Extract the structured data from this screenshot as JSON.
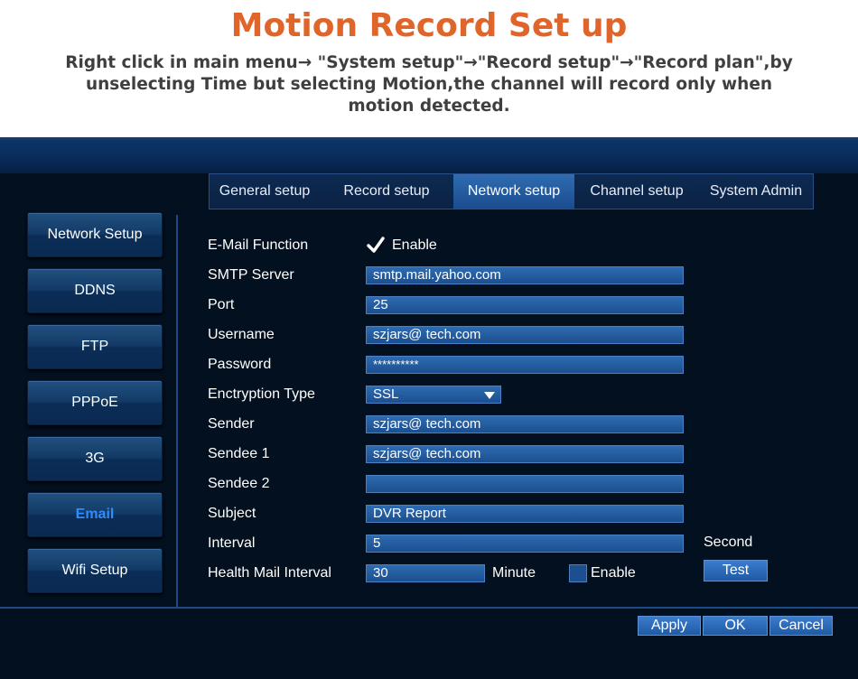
{
  "banner": {
    "title": "Motion Record Set up",
    "subtitle": "Right click in main menu→ \"System setup\"→\"Record setup\"→\"Record plan\",by unselecting Time but selecting Motion,the channel will record only when motion detected."
  },
  "tabs": [
    {
      "label": "General setup"
    },
    {
      "label": "Record setup"
    },
    {
      "label": "Network setup",
      "active": true
    },
    {
      "label": "Channel setup"
    },
    {
      "label": "System Admin"
    }
  ],
  "sidebar": [
    {
      "label": "Network Setup"
    },
    {
      "label": "DDNS"
    },
    {
      "label": "FTP"
    },
    {
      "label": "PPPoE"
    },
    {
      "label": "3G"
    },
    {
      "label": "Email",
      "active": true
    },
    {
      "label": "Wifi Setup"
    }
  ],
  "form": {
    "email_function": {
      "label": "E-Mail Function",
      "checkbox_label": "Enable",
      "checked": true
    },
    "smtp_server": {
      "label": "SMTP Server",
      "value": "smtp.mail.yahoo.com"
    },
    "port": {
      "label": "Port",
      "value": "25"
    },
    "username": {
      "label": "Username",
      "value": "szjars@ tech.com"
    },
    "password": {
      "label": "Password",
      "value": "**********"
    },
    "encryption": {
      "label": "Enctryption Type",
      "value": "SSL"
    },
    "sender": {
      "label": "Sender",
      "value": "szjars@ tech.com"
    },
    "sendee1": {
      "label": "Sendee 1",
      "value": "szjars@ tech.com"
    },
    "sendee2": {
      "label": "Sendee 2",
      "value": ""
    },
    "subject": {
      "label": "Subject",
      "value": "DVR Report"
    },
    "interval": {
      "label": "Interval",
      "value": "5",
      "unit": "Second"
    },
    "health_mail": {
      "label": "Health Mail Interval",
      "value": "30",
      "unit": "Minute",
      "checkbox_label": "Enable",
      "checked": false
    }
  },
  "buttons": {
    "test": "Test",
    "apply": "Apply",
    "ok": "OK",
    "cancel": "Cancel"
  },
  "colors": {
    "title": "#e0652a",
    "accent_active": "#2f8cff",
    "field_bg": "#1b4f90",
    "screen_bg": "#03101f"
  }
}
